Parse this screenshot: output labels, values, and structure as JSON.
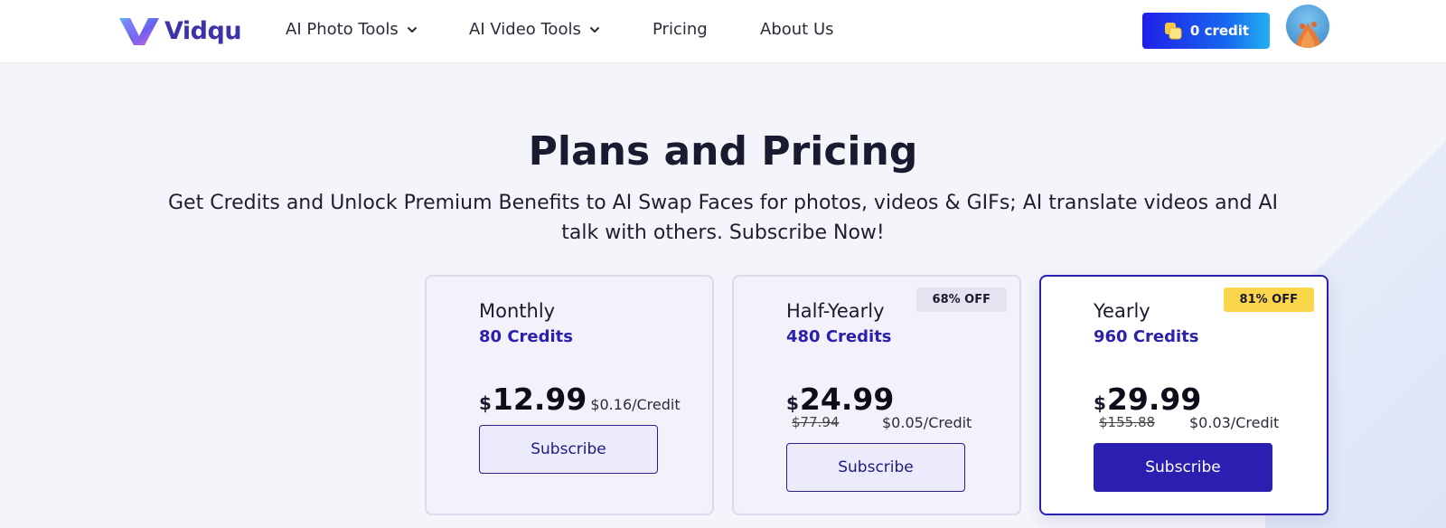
{
  "header": {
    "logo_text": "Vidqu",
    "nav": [
      {
        "label": "AI Photo Tools",
        "has_dropdown": true
      },
      {
        "label": "AI Video Tools",
        "has_dropdown": true
      },
      {
        "label": "Pricing",
        "has_dropdown": false
      },
      {
        "label": "About Us",
        "has_dropdown": false
      }
    ],
    "credit_label": "0 credit",
    "icons": {
      "logo": "vidqu-logo-icon",
      "credit": "coin-icon",
      "dropdown": "chevron-down-icon",
      "avatar": "avatar"
    }
  },
  "hero": {
    "title": "Plans and Pricing",
    "subtitle": "Get Credits and Unlock Premium Benefits to AI Swap Faces for photos, videos & GIFs; AI translate videos and AI talk with others. Subscribe Now!"
  },
  "plans": [
    {
      "name": "Monthly",
      "credits": "80 Credits",
      "currency": "$",
      "price": "12.99",
      "per_credit": "$0.16/Credit",
      "original_price": "",
      "badge": "",
      "button": "Subscribe",
      "selected": false
    },
    {
      "name": "Half-Yearly",
      "credits": "480 Credits",
      "currency": "$",
      "price": "24.99",
      "per_credit": "$0.05/Credit",
      "original_price": "$77.94",
      "badge": "68% OFF",
      "button": "Subscribe",
      "selected": false
    },
    {
      "name": "Yearly",
      "credits": "960 Credits",
      "currency": "$",
      "price": "29.99",
      "per_credit": "$0.03/Credit",
      "original_price": "$155.88",
      "badge": "81% OFF",
      "button": "Subscribe",
      "selected": true
    }
  ],
  "colors": {
    "brand": "#2a1fb0",
    "credits_text": "#2a22a8",
    "badge_highlight": "#fbd54a",
    "credit_button_start": "#2020e8",
    "credit_button_end": "#22b0f0"
  }
}
